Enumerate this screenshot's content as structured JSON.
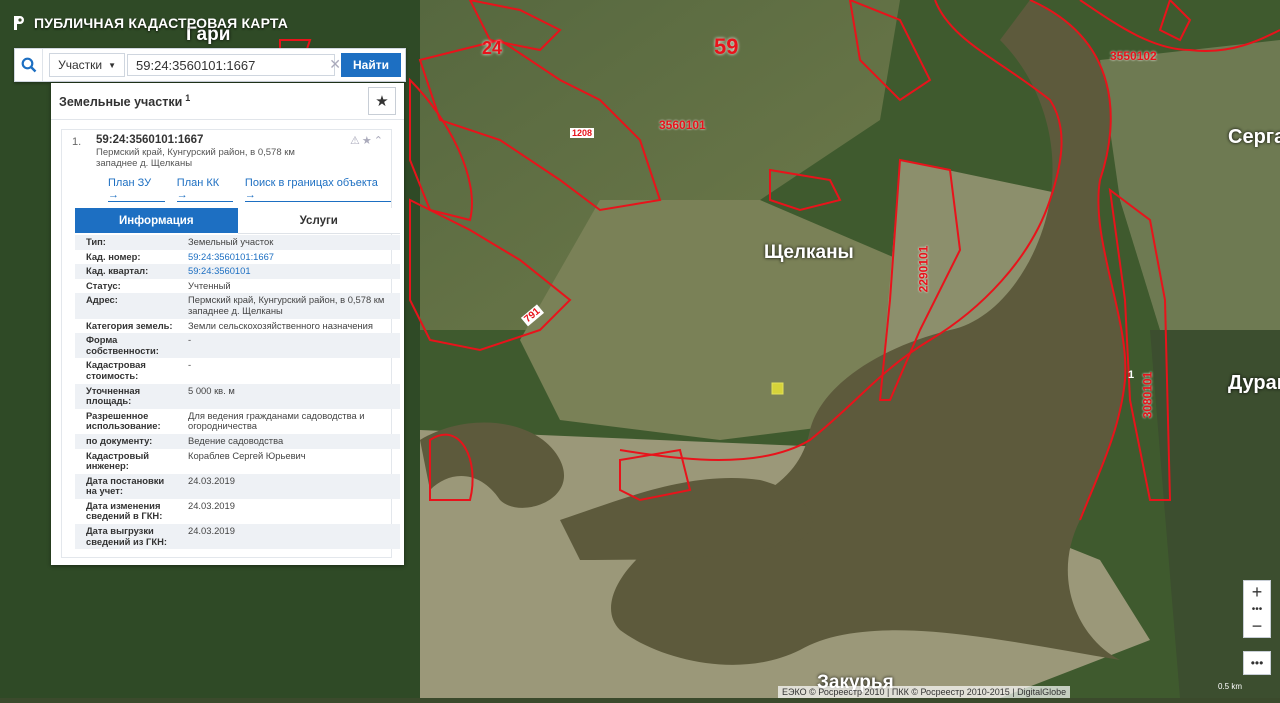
{
  "app": {
    "title": "ПУБЛИЧНАЯ КАДАСТРОВАЯ КАРТА"
  },
  "search": {
    "type_label": "Участки",
    "query": "59:24:3560101:1667",
    "find_button": "Найти"
  },
  "results_panel": {
    "title": "Земельные участки",
    "count": "1",
    "card": {
      "number": "1.",
      "cad_number": "59:24:3560101:1667",
      "address_short": "Пермский край, Кунгурский район, в 0,578 км западнее д. Щелканы",
      "links": [
        "План ЗУ →",
        "План КК →",
        "Поиск в границах объекта →"
      ],
      "tabs": [
        "Информация",
        "Услуги"
      ],
      "rows": [
        {
          "key": "Тип:",
          "value": "Земельный участок"
        },
        {
          "key": "Кад. номер:",
          "value": "59:24:3560101:1667"
        },
        {
          "key": "Кад. квартал:",
          "value": "59:24:3560101"
        },
        {
          "key": "Статус:",
          "value": "Учтенный"
        },
        {
          "key": "Адрес:",
          "value": "Пермский край, Кунгурский район, в 0,578 км западнее д. Щелканы"
        },
        {
          "key": "Категория земель:",
          "value": "Земли сельскохозяйственного назначения"
        },
        {
          "key": "Форма собственности:",
          "value": "-"
        },
        {
          "key": "Кадастровая стоимость:",
          "value": "-"
        },
        {
          "key": "Уточненная площадь:",
          "value": "5 000 кв. м"
        },
        {
          "key": "Разрешенное использование:",
          "value": "Для ведения гражданами садоводства и огородничества"
        },
        {
          "key": "по документу:",
          "value": "Ведение садоводства"
        },
        {
          "key": "Кадастровый инженер:",
          "value": "Кораблев Сергей Юрьевич"
        },
        {
          "key": "Дата постановки на учет:",
          "value": "24.03.2019"
        },
        {
          "key": "Дата изменения сведений в ГКН:",
          "value": "24.03.2019"
        },
        {
          "key": "Дата выгрузки сведений из ГКН:",
          "value": "24.03.2019"
        }
      ]
    }
  },
  "map_labels": {
    "place_gari": "Гари",
    "place_shchelkany": "Щелканы",
    "place_serga": "Серга",
    "place_durak": "Дурак",
    "place_zakurya": "Закурья",
    "region_59": "59",
    "district_24": "24",
    "quarter_3560101": "3560101",
    "quarter_3550102": "3550102",
    "quarter_2290101": "2290101",
    "quarter_3080101": "3080101",
    "parcel_1208": "1208",
    "parcel_791": "791",
    "parcel_1": "1"
  },
  "attribution": "ЕЭКО © Росреестр 2010 | ПКК © Росреестр 2010-2015 | DigitalGlobe",
  "scale_label": "0.5 km",
  "colors": {
    "boundary": "#e8131b",
    "accent": "#1d6fc2",
    "river": "#5d5a3c",
    "parcel_highlight": "#d6d33a"
  }
}
